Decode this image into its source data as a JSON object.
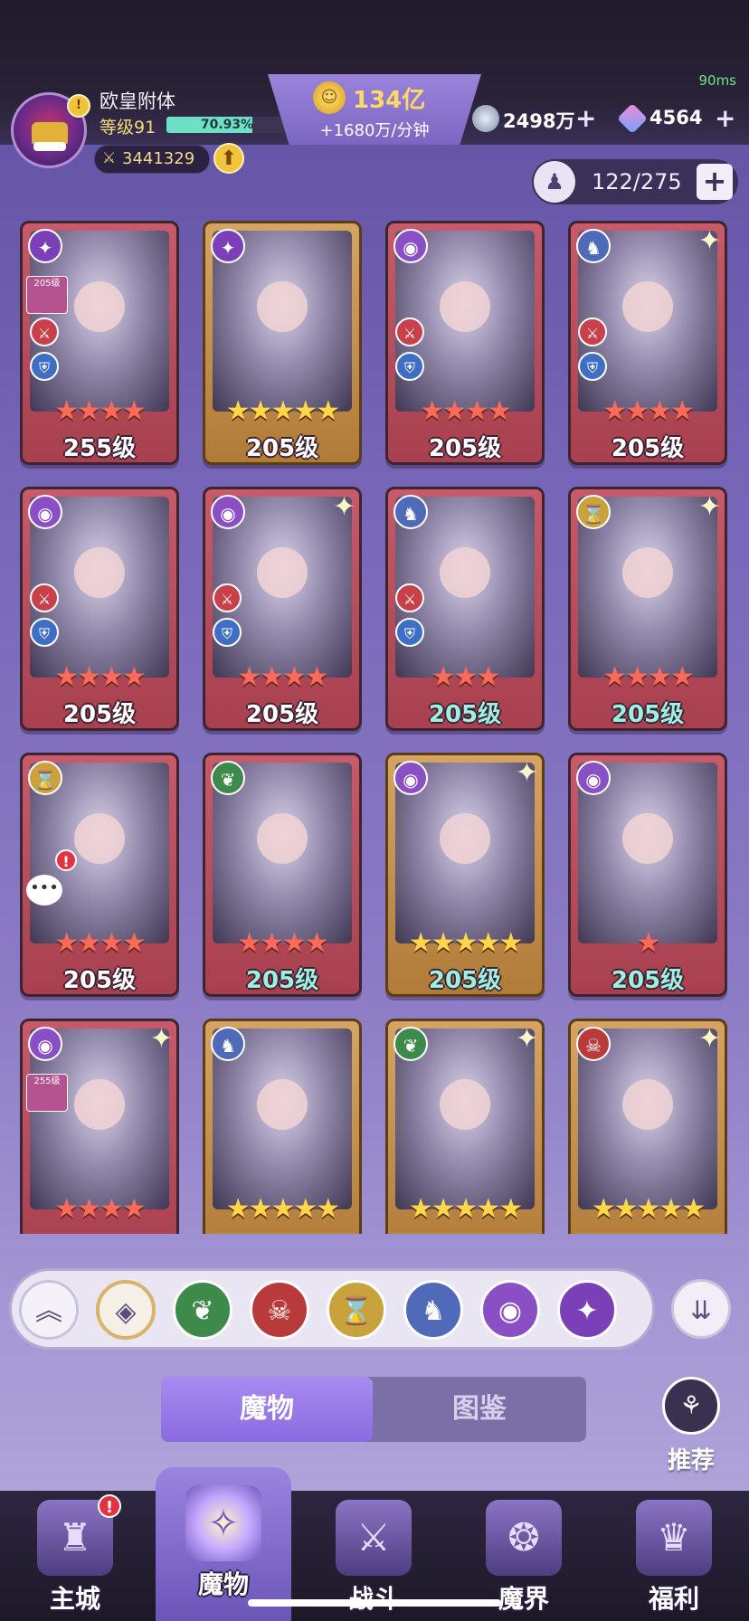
{
  "header": {
    "ping": "90ms",
    "player_name": "欧皇附体",
    "level_label": "等级91",
    "exp_percent_text": "70.93%",
    "exp_fraction": 0.7093,
    "avatar_badge": "!",
    "power_value": "3441329",
    "gold_amount": "134亿",
    "gold_rate": "+1680万/分钟",
    "silver_amount": "2498万",
    "gem_amount": "4564",
    "plus_label": "+",
    "capacity_value": "122/275",
    "capacity_plus": "+"
  },
  "cards": [
    {
      "element": "purple-swirl",
      "elem_glyph": "✦",
      "elem_color": "e-violet",
      "frame": "red",
      "stars": "★★★★",
      "star_color": "red",
      "level": "255级",
      "level_color": "white",
      "has_roles": true,
      "mini_badge": "205级",
      "sparkle": false
    },
    {
      "element": "purple-swirl",
      "elem_glyph": "✦",
      "elem_color": "e-violet",
      "frame": "gold",
      "stars": "★★★★★",
      "star_color": "gold",
      "level": "205级",
      "level_color": "white",
      "has_roles": false,
      "sparkle": false
    },
    {
      "element": "eye",
      "elem_glyph": "◉",
      "elem_color": "e-purple",
      "frame": "red",
      "stars": "★★★★",
      "star_color": "red",
      "level": "205级",
      "level_color": "white",
      "has_roles": true,
      "sparkle": false
    },
    {
      "element": "dragon",
      "elem_glyph": "♞",
      "elem_color": "e-blue",
      "frame": "red",
      "stars": "★★★★",
      "star_color": "red",
      "level": "205级",
      "level_color": "white",
      "has_roles": true,
      "sparkle": true
    },
    {
      "element": "eye",
      "elem_glyph": "◉",
      "elem_color": "e-purple",
      "frame": "red",
      "stars": "★★★★",
      "star_color": "red",
      "level": "205级",
      "level_color": "white",
      "has_roles": true,
      "sparkle": false
    },
    {
      "element": "eye",
      "elem_glyph": "◉",
      "elem_color": "e-purple",
      "frame": "red",
      "stars": "★★★★",
      "star_color": "red",
      "level": "205级",
      "level_color": "white",
      "has_roles": true,
      "sparkle": true
    },
    {
      "element": "dragon",
      "elem_glyph": "♞",
      "elem_color": "e-blue",
      "frame": "red",
      "stars": "★★★",
      "star_color": "red",
      "level": "205级",
      "level_color": "teal",
      "has_roles": true,
      "sparkle": false
    },
    {
      "element": "hourglass",
      "elem_glyph": "⌛",
      "elem_color": "e-gold",
      "frame": "red",
      "stars": "★★★★",
      "star_color": "red",
      "level": "205级",
      "level_color": "teal",
      "has_roles": false,
      "sparkle": true
    },
    {
      "element": "hourglass",
      "elem_glyph": "⌛",
      "elem_color": "e-gold",
      "frame": "red",
      "stars": "★★★★",
      "star_color": "red",
      "level": "205级",
      "level_color": "white",
      "has_roles": false,
      "alert": true,
      "chat": true,
      "sparkle": false
    },
    {
      "element": "leaf",
      "elem_glyph": "❦",
      "elem_color": "e-green",
      "frame": "red",
      "stars": "★★★★",
      "star_color": "red",
      "level": "205级",
      "level_color": "teal",
      "has_roles": false,
      "sparkle": false
    },
    {
      "element": "eye",
      "elem_glyph": "◉",
      "elem_color": "e-purple",
      "frame": "gold",
      "stars": "★★★★★",
      "star_color": "gold",
      "level": "205级",
      "level_color": "teal",
      "has_roles": false,
      "sparkle": true
    },
    {
      "element": "eye",
      "elem_glyph": "◉",
      "elem_color": "e-purple",
      "frame": "red",
      "stars": "★",
      "star_color": "red",
      "level": "205级",
      "level_color": "teal",
      "has_roles": false,
      "sparkle": false
    },
    {
      "element": "eye",
      "elem_glyph": "◉",
      "elem_color": "e-purple",
      "frame": "red",
      "stars": "★★★★",
      "star_color": "red",
      "level": "",
      "level_color": "white",
      "has_roles": false,
      "mini_badge": "255级",
      "sparkle": true
    },
    {
      "element": "dragon",
      "elem_glyph": "♞",
      "elem_color": "e-blue",
      "frame": "gold",
      "stars": "★★★★★",
      "star_color": "gold",
      "level": "",
      "level_color": "white",
      "has_roles": false,
      "sparkle": false
    },
    {
      "element": "leaf",
      "elem_glyph": "❦",
      "elem_color": "e-green",
      "frame": "gold",
      "stars": "★★★★★",
      "star_color": "gold",
      "level": "",
      "level_color": "white",
      "has_roles": false,
      "sparkle": true
    },
    {
      "element": "demon",
      "elem_glyph": "☠",
      "elem_color": "e-red",
      "frame": "gold",
      "stars": "★★★★★",
      "star_color": "gold",
      "level": "",
      "level_color": "white",
      "has_roles": false,
      "sparkle": true
    }
  ],
  "filters": [
    {
      "name": "collapse",
      "glyph": "︽",
      "color": "f-collapse"
    },
    {
      "name": "all",
      "glyph": "◈",
      "color": "f-all"
    },
    {
      "name": "leaf",
      "glyph": "❦",
      "color": "e-green"
    },
    {
      "name": "demon",
      "glyph": "☠",
      "color": "e-red"
    },
    {
      "name": "hourglass",
      "glyph": "⌛",
      "color": "e-gold"
    },
    {
      "name": "dragon",
      "glyph": "♞",
      "color": "e-blue"
    },
    {
      "name": "eye",
      "glyph": "◉",
      "color": "e-purple"
    },
    {
      "name": "swirl",
      "glyph": "✦",
      "color": "e-violet"
    }
  ],
  "sort_glyph": "⇊",
  "tabs": {
    "monsters": "魔物",
    "codex": "图鉴"
  },
  "recommend_label": "推荐",
  "nav": [
    {
      "name": "main-city",
      "label": "主城",
      "glyph": "♜",
      "badge": "!"
    },
    {
      "name": "monsters",
      "label": "魔物",
      "glyph": "✧",
      "active": true
    },
    {
      "name": "battle",
      "label": "战斗",
      "glyph": "⚔"
    },
    {
      "name": "demon-realm",
      "label": "魔界",
      "glyph": "❂"
    },
    {
      "name": "welfare",
      "label": "福利",
      "glyph": "♛"
    }
  ]
}
